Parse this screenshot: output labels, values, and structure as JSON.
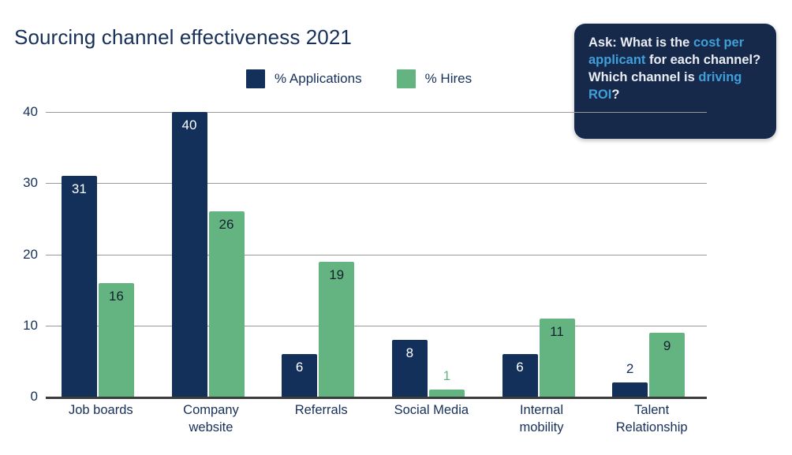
{
  "title": "Sourcing channel effectiveness 2021",
  "legend": [
    {
      "label": "% Applications",
      "color": "#13305a",
      "key": "applications"
    },
    {
      "label": "% Hires",
      "color": "#64b481",
      "key": "hires"
    }
  ],
  "callout": {
    "segments": [
      {
        "text": "Ask: What is the ",
        "highlight": false
      },
      {
        "text": "cost per applicant",
        "highlight": true
      },
      {
        "text": " for each channel? Which channel is ",
        "highlight": false
      },
      {
        "text": "driving ROI",
        "highlight": true
      },
      {
        "text": "?",
        "highlight": false
      }
    ],
    "plain_text": "Ask: What is the cost per applicant for each channel? Which channel is driving ROI?",
    "background": "#17294b",
    "highlight_color": "#3f9fd9"
  },
  "chart_data": {
    "type": "bar",
    "title": "Sourcing channel effectiveness 2021",
    "xlabel": "",
    "ylabel": "",
    "ylim": [
      0,
      40
    ],
    "yticks": [
      0,
      10,
      20,
      30,
      40
    ],
    "grid": true,
    "legend_position": "top-center",
    "categories": [
      "Job boards",
      "Company website",
      "Referrals",
      "Social Media",
      "Internal mobility",
      "Talent Relationship"
    ],
    "category_lines": [
      [
        "Job boards"
      ],
      [
        "Company",
        "website"
      ],
      [
        "Referrals"
      ],
      [
        "Social Media"
      ],
      [
        "Internal",
        "mobility"
      ],
      [
        "Talent",
        "Relationship"
      ]
    ],
    "series": [
      {
        "name": "% Applications",
        "color": "#13305a",
        "values": [
          31,
          40,
          6,
          8,
          6,
          2
        ],
        "label_placement": [
          "inside",
          "inside",
          "inside",
          "inside",
          "inside",
          "outside"
        ]
      },
      {
        "name": "% Hires",
        "color": "#64b481",
        "values": [
          16,
          26,
          19,
          1,
          11,
          9
        ],
        "label_placement": [
          "inside",
          "inside",
          "inside",
          "outside",
          "inside",
          "inside"
        ]
      }
    ]
  }
}
